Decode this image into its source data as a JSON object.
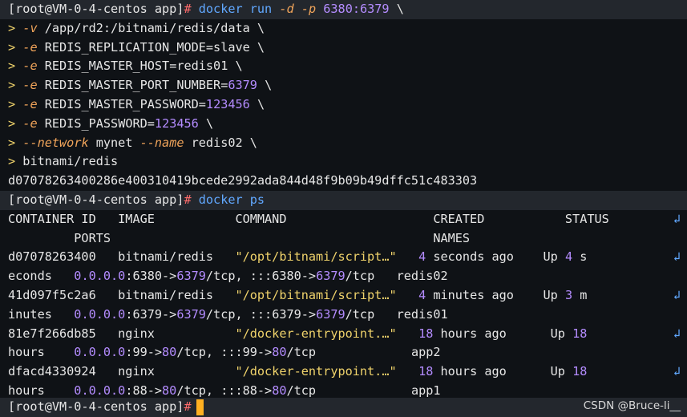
{
  "window": {
    "prompt": "[root@VM-0-4-centos app]",
    "hash": "#"
  },
  "run_cmd": {
    "l1_cmd": "docker run",
    "l1_d": "-d",
    "l1_p": "-p",
    "l1_ports": "6380:6379",
    "l1_tail": " \\",
    "l2_flag": "-v",
    "l2_arg": " /app/rd2:/bitnami/redis/data \\",
    "l3_flag": "-e",
    "l3_arg": " REDIS_REPLICATION_MODE=slave \\",
    "l4_flag": "-e",
    "l4_arg": " REDIS_MASTER_HOST=redis01 \\",
    "l5_flag": "-e",
    "l5_arg_a": " REDIS_MASTER_PORT_NUMBER=",
    "l5_num": "6379",
    "l5_tail": " \\",
    "l6_flag": "-e",
    "l6_arg_a": " REDIS_MASTER_PASSWORD=",
    "l6_num": "123456",
    "l6_tail": " \\",
    "l7_flag": "-e",
    "l7_arg_a": " REDIS_PASSWORD=",
    "l7_num": "123456",
    "l7_tail": " \\",
    "l8_flag1": "--network",
    "l8_arg1": " mynet ",
    "l8_flag2": "--name",
    "l8_arg2": " redis02 \\",
    "l9_arg": " bitnami/redis",
    "continuation": ">",
    "container_hash": "d07078263400286e400310419bcede2992ada844d48f9b09b49dffc51c483303"
  },
  "ps_cmd": "docker ps",
  "ps_header": {
    "line1": "CONTAINER ID   IMAGE           COMMAND                    CREATED           STATUS",
    "line2": "         PORTS                                            NAMES"
  },
  "rows": [
    {
      "a_id": "d07078263400   bitnami/redis   ",
      "a_cmd": "\"/opt/bitnami/script…\"",
      "a_sp": "   ",
      "a_num": "4",
      "a_created": " seconds ago    Up ",
      "a_num2": "4",
      "a_status": " s",
      "b_pre": "econds   ",
      "b_ip": "0.0.0.0",
      "b_p1": ":6380->",
      "b_p1n": "6379",
      "b_p2": "/tcp, :::6380->",
      "b_p2n": "6379",
      "b_p3": "/tcp   redis02"
    },
    {
      "a_id": "41d097f5c2a6   bitnami/redis   ",
      "a_cmd": "\"/opt/bitnami/script…\"",
      "a_sp": "   ",
      "a_num": "4",
      "a_created": " minutes ago    Up ",
      "a_num2": "3",
      "a_status": " m",
      "b_pre": "inutes   ",
      "b_ip": "0.0.0.0",
      "b_p1": ":6379->",
      "b_p1n": "6379",
      "b_p2": "/tcp, :::6379->",
      "b_p2n": "6379",
      "b_p3": "/tcp   redis01"
    },
    {
      "a_id": "81e7f266db85   nginx           ",
      "a_cmd": "\"/docker-entrypoint.…\"",
      "a_sp": "   ",
      "a_num": "18",
      "a_created": " hours ago      Up ",
      "a_num2": "18",
      "a_status": " ",
      "b_pre": "hours    ",
      "b_ip": "0.0.0.0",
      "b_p1": ":99->",
      "b_p1n": "80",
      "b_p2": "/tcp, :::99->",
      "b_p2n": "80",
      "b_p3": "/tcp             app2"
    },
    {
      "a_id": "dfacd4330924   nginx           ",
      "a_cmd": "\"/docker-entrypoint.…\"",
      "a_sp": "   ",
      "a_num": "18",
      "a_created": " hours ago      Up ",
      "a_num2": "18",
      "a_status": " ",
      "b_pre": "hours    ",
      "b_ip": "0.0.0.0",
      "b_p1": ":88->",
      "b_p1n": "80",
      "b_p2": "/tcp, :::88->",
      "b_p2n": "80",
      "b_p3": "/tcp             app1"
    }
  ],
  "wrap_glyph": "↲",
  "watermark": "CSDN @Bruce-li__"
}
